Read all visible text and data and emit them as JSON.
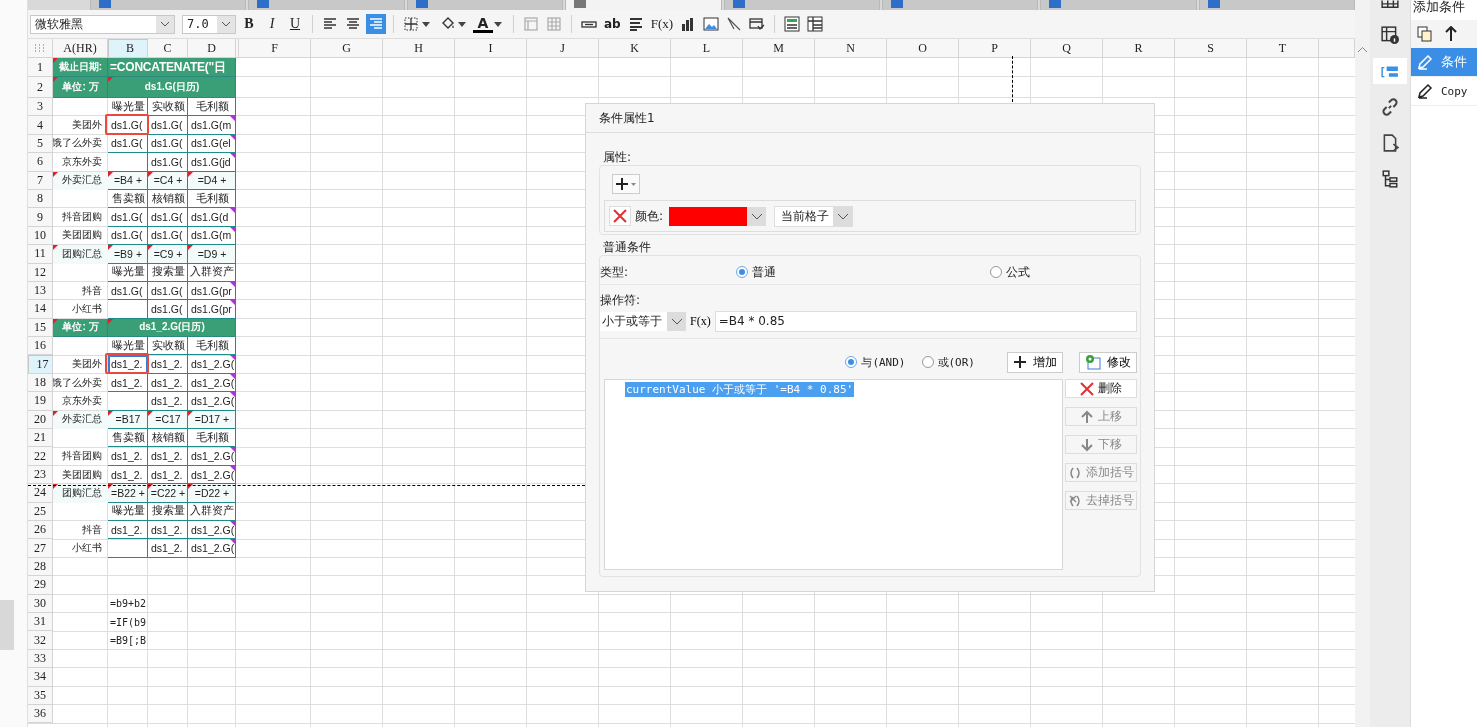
{
  "tabs": [
    {
      "selected": false
    },
    {
      "selected": false
    },
    {
      "selected": false
    },
    {
      "selected": true
    },
    {
      "selected": false
    },
    {
      "selected": false
    },
    {
      "selected": false
    },
    {
      "selected": false
    }
  ],
  "toolbar": {
    "font": "微软雅黑",
    "size": "7.0",
    "tools": [
      {
        "kind": "bold",
        "text": "B",
        "selected": false
      },
      {
        "kind": "italic",
        "text": "I",
        "selected": false
      },
      {
        "kind": "underline",
        "text": "U",
        "selected": false
      },
      {
        "kind": "align-left",
        "selected": false
      },
      {
        "kind": "align-center",
        "selected": false
      },
      {
        "kind": "align-right",
        "selected": true
      },
      {
        "kind": "borders",
        "selected": false
      },
      {
        "kind": "fill",
        "selected": false
      },
      {
        "kind": "font-color",
        "text": "A",
        "selected": false
      },
      {
        "kind": "cell-frame",
        "selected": false
      },
      {
        "kind": "grid",
        "selected": false
      },
      {
        "kind": "textbox",
        "selected": false
      },
      {
        "kind": "text",
        "text": "ab",
        "selected": false
      },
      {
        "kind": "paragraph",
        "selected": false
      },
      {
        "kind": "formula",
        "text": "F(x)",
        "selected": false
      },
      {
        "kind": "chart",
        "selected": false
      },
      {
        "kind": "image",
        "selected": false
      },
      {
        "kind": "slash",
        "selected": false
      },
      {
        "kind": "stamp",
        "selected": false
      },
      {
        "kind": "panel",
        "selected": false
      },
      {
        "kind": "table",
        "selected": false
      }
    ]
  },
  "sheet": {
    "columns": [
      {
        "label": "A(HR)",
        "selected": false
      },
      {
        "label": "B",
        "selected": true
      },
      {
        "label": "C",
        "selected": false
      },
      {
        "label": "D",
        "selected": false
      },
      {
        "label": "F",
        "selected": false
      },
      {
        "label": "G",
        "selected": false
      },
      {
        "label": "H",
        "selected": false
      },
      {
        "label": "I",
        "selected": false
      },
      {
        "label": "J",
        "selected": false
      },
      {
        "label": "K",
        "selected": false
      },
      {
        "label": "L",
        "selected": false
      },
      {
        "label": "M",
        "selected": false
      },
      {
        "label": "N",
        "selected": false
      },
      {
        "label": "O",
        "selected": false
      },
      {
        "label": "P",
        "selected": false
      },
      {
        "label": "Q",
        "selected": false
      },
      {
        "label": "R",
        "selected": false
      },
      {
        "label": "S",
        "selected": false
      },
      {
        "label": "T",
        "selected": false
      }
    ],
    "rows": [
      {
        "num": "1",
        "kind": "title",
        "merged": true,
        "selected": false,
        "cells": [
          {
            "text": "截止日期:",
            "flag": true
          },
          {
            "text": "=CONCATENATE(\"日"
          }
        ]
      },
      {
        "num": "2",
        "kind": "title",
        "merged": true,
        "selected": false,
        "cells": [
          {
            "text": "单位: 万",
            "flag": true
          },
          {
            "text": "ds1.G(日历)",
            "flag": true
          }
        ]
      },
      {
        "num": "3",
        "kind": "head",
        "selected": false,
        "cells": [
          {
            "text": ""
          },
          {
            "text": "曝光量"
          },
          {
            "text": "实收额"
          },
          {
            "text": "毛利额"
          }
        ]
      },
      {
        "num": "4",
        "kind": "data",
        "selected": false,
        "cells": [
          {
            "text": "美团外"
          },
          {
            "text": "ds1.G("
          },
          {
            "text": "ds1.G("
          },
          {
            "text": "ds1.G(m",
            "more": true
          }
        ]
      },
      {
        "num": "5",
        "kind": "data",
        "selected": false,
        "cells": [
          {
            "text": "饿了么外卖"
          },
          {
            "text": "ds1.G("
          },
          {
            "text": "ds1.G("
          },
          {
            "text": "ds1.G(el",
            "more": true
          }
        ]
      },
      {
        "num": "6",
        "kind": "data",
        "selected": false,
        "cells": [
          {
            "text": "京东外卖"
          },
          {
            "text": ""
          },
          {
            "text": "ds1.G("
          },
          {
            "text": "ds1.G(jd",
            "more": true
          }
        ]
      },
      {
        "num": "7",
        "kind": "total",
        "selected": false,
        "cells": [
          {
            "text": "外卖汇总",
            "flag": true
          },
          {
            "text": "=B4 +",
            "flag": true
          },
          {
            "text": "=C4 +",
            "flag": true
          },
          {
            "text": "=D4 +",
            "flag": true
          }
        ]
      },
      {
        "num": "8",
        "kind": "head",
        "selected": false,
        "cells": [
          {
            "text": ""
          },
          {
            "text": "售卖额"
          },
          {
            "text": "核销额"
          },
          {
            "text": "毛利额"
          }
        ]
      },
      {
        "num": "9",
        "kind": "data",
        "selected": false,
        "cells": [
          {
            "text": "抖音团购"
          },
          {
            "text": "ds1.G("
          },
          {
            "text": "ds1.G("
          },
          {
            "text": "ds1.G(d",
            "more": true
          }
        ]
      },
      {
        "num": "10",
        "kind": "data",
        "selected": false,
        "cells": [
          {
            "text": "美团团购"
          },
          {
            "text": "ds1.G("
          },
          {
            "text": "ds1.G("
          },
          {
            "text": "ds1.G(m",
            "more": true
          }
        ]
      },
      {
        "num": "11",
        "kind": "total",
        "selected": false,
        "cells": [
          {
            "text": "团购汇总",
            "flag": true
          },
          {
            "text": "=B9 +",
            "flag": true
          },
          {
            "text": "=C9 +",
            "flag": true
          },
          {
            "text": "=D9 +",
            "flag": true
          }
        ]
      },
      {
        "num": "12",
        "kind": "head",
        "selected": false,
        "cells": [
          {
            "text": ""
          },
          {
            "text": "曝光量"
          },
          {
            "text": "搜索量"
          },
          {
            "text": "入群资产"
          }
        ]
      },
      {
        "num": "13",
        "kind": "data",
        "selected": false,
        "cells": [
          {
            "text": "抖音"
          },
          {
            "text": "ds1.G("
          },
          {
            "text": "ds1.G("
          },
          {
            "text": "ds1.G(pr",
            "more": true
          }
        ]
      },
      {
        "num": "14",
        "kind": "data",
        "selected": false,
        "cells": [
          {
            "text": "小红书"
          },
          {
            "text": ""
          },
          {
            "text": "ds1.G("
          },
          {
            "text": "ds1.G(pr",
            "more": true
          }
        ]
      },
      {
        "num": "15",
        "kind": "title",
        "merged": true,
        "selected": false,
        "cells": [
          {
            "text": "单位: 万",
            "flag": true
          },
          {
            "text": "ds1_2.G(日历)",
            "flag": true
          }
        ]
      },
      {
        "num": "16",
        "kind": "head",
        "selected": false,
        "cells": [
          {
            "text": ""
          },
          {
            "text": "曝光量"
          },
          {
            "text": "实收额"
          },
          {
            "text": "毛利额"
          }
        ]
      },
      {
        "num": "17",
        "kind": "data",
        "selected": true,
        "cells": [
          {
            "text": "美团外"
          },
          {
            "text": "ds1_2."
          },
          {
            "text": "ds1_2."
          },
          {
            "text": "ds1_2.G(",
            "more": true
          }
        ]
      },
      {
        "num": "18",
        "kind": "data",
        "selected": false,
        "cells": [
          {
            "text": "饿了么外卖"
          },
          {
            "text": "ds1_2."
          },
          {
            "text": "ds1_2."
          },
          {
            "text": "ds1_2.G(",
            "more": true
          }
        ]
      },
      {
        "num": "19",
        "kind": "data",
        "selected": false,
        "cells": [
          {
            "text": "京东外卖"
          },
          {
            "text": ""
          },
          {
            "text": "ds1_2."
          },
          {
            "text": "ds1_2.G(",
            "more": true
          }
        ]
      },
      {
        "num": "20",
        "kind": "total",
        "selected": false,
        "cells": [
          {
            "text": "外卖汇总",
            "flag": true
          },
          {
            "text": "=B17",
            "flag": true
          },
          {
            "text": "=C17",
            "flag": true
          },
          {
            "text": "=D17 +",
            "flag": true
          }
        ]
      },
      {
        "num": "21",
        "kind": "head",
        "selected": false,
        "cells": [
          {
            "text": ""
          },
          {
            "text": "售卖额"
          },
          {
            "text": "核销额"
          },
          {
            "text": "毛利额"
          }
        ]
      },
      {
        "num": "22",
        "kind": "data",
        "selected": false,
        "cells": [
          {
            "text": "抖音团购"
          },
          {
            "text": "ds1_2."
          },
          {
            "text": "ds1_2."
          },
          {
            "text": "ds1_2.G(",
            "more": true
          }
        ]
      },
      {
        "num": "23",
        "kind": "data",
        "selected": false,
        "cells": [
          {
            "text": "美团团购"
          },
          {
            "text": "ds1_2."
          },
          {
            "text": "ds1_2."
          },
          {
            "text": "ds1_2.G(",
            "more": true
          }
        ]
      },
      {
        "num": "24",
        "kind": "total",
        "selected": false,
        "cells": [
          {
            "text": "团购汇总",
            "flag": true
          },
          {
            "text": "=B22 +",
            "flag": true
          },
          {
            "text": "=C22 +",
            "flag": true
          },
          {
            "text": "=D22 +",
            "flag": true
          }
        ]
      },
      {
        "num": "25",
        "kind": "head",
        "selected": false,
        "cells": [
          {
            "text": ""
          },
          {
            "text": "曝光量"
          },
          {
            "text": "搜索量"
          },
          {
            "text": "入群资产"
          }
        ]
      },
      {
        "num": "26",
        "kind": "data",
        "selected": false,
        "cells": [
          {
            "text": "抖音"
          },
          {
            "text": "ds1_2."
          },
          {
            "text": "ds1_2."
          },
          {
            "text": "ds1_2.G(",
            "more": true
          }
        ]
      },
      {
        "num": "27",
        "kind": "data",
        "selected": false,
        "cells": [
          {
            "text": "小红书"
          },
          {
            "text": ""
          },
          {
            "text": "ds1_2."
          },
          {
            "text": "ds1_2.G(",
            "more": true
          }
        ]
      },
      {
        "num": "28",
        "kind": "plain",
        "selected": false,
        "cells": []
      },
      {
        "num": "29",
        "kind": "plain",
        "selected": false,
        "cells": []
      },
      {
        "num": "30",
        "kind": "plain",
        "selected": false,
        "cells": [
          {
            "text": ""
          },
          {
            "text": "=b9+b2"
          }
        ]
      },
      {
        "num": "31",
        "kind": "plain",
        "selected": false,
        "cells": [
          {
            "text": ""
          },
          {
            "text": "=IF(b9"
          }
        ]
      },
      {
        "num": "32",
        "kind": "plain",
        "selected": false,
        "cells": [
          {
            "text": ""
          },
          {
            "text": "=B9[;B"
          }
        ]
      },
      {
        "num": "33",
        "kind": "plain",
        "selected": false,
        "cells": []
      },
      {
        "num": "34",
        "kind": "plain",
        "selected": false,
        "cells": []
      },
      {
        "num": "35",
        "kind": "plain",
        "selected": false,
        "cells": []
      },
      {
        "num": "36",
        "kind": "plain",
        "selected": false,
        "cells": []
      }
    ]
  },
  "dialog": {
    "title": "条件属性1",
    "attr_label": "属性:",
    "attributes": [
      {
        "label": "颜色:",
        "color": "#ff0000",
        "scope": "当前格子"
      }
    ],
    "cond_label": "普通条件",
    "type_label": "类型:",
    "types": [
      {
        "label": "普通",
        "selected": true
      },
      {
        "label": "公式",
        "selected": false
      }
    ],
    "operator_label": "操作符:",
    "operator": "小于或等于",
    "fx": "F(x)",
    "formula": "=B4 * 0.85",
    "joins": [
      {
        "label": "与(AND)",
        "selected": true
      },
      {
        "label": "或(OR)",
        "selected": false
      }
    ],
    "add": "增加",
    "modify": "修改",
    "list": [
      {
        "text": "currentValue 小于或等于 '=B4 * 0.85'",
        "selected": true
      }
    ],
    "actions": [
      {
        "kind": "delete",
        "label": "删除",
        "disabled": false
      },
      {
        "kind": "up",
        "label": "上移",
        "disabled": true
      },
      {
        "kind": "down",
        "label": "下移",
        "disabled": true
      },
      {
        "kind": "add-bracket",
        "label": "添加括号",
        "disabled": true
      },
      {
        "kind": "remove-bracket",
        "label": "去掉括号",
        "disabled": true
      }
    ]
  },
  "side_icons": [
    {
      "kind": "grid",
      "selected": false
    },
    {
      "kind": "table-info",
      "selected": false
    },
    {
      "kind": "condition",
      "selected": true
    },
    {
      "kind": "link",
      "selected": false
    },
    {
      "kind": "page",
      "selected": false
    },
    {
      "kind": "tree",
      "selected": false
    }
  ],
  "panel": {
    "title": "添加条件",
    "items": [
      {
        "label": "条件",
        "selected": true
      },
      {
        "label": "Copy",
        "selected": false
      }
    ]
  }
}
